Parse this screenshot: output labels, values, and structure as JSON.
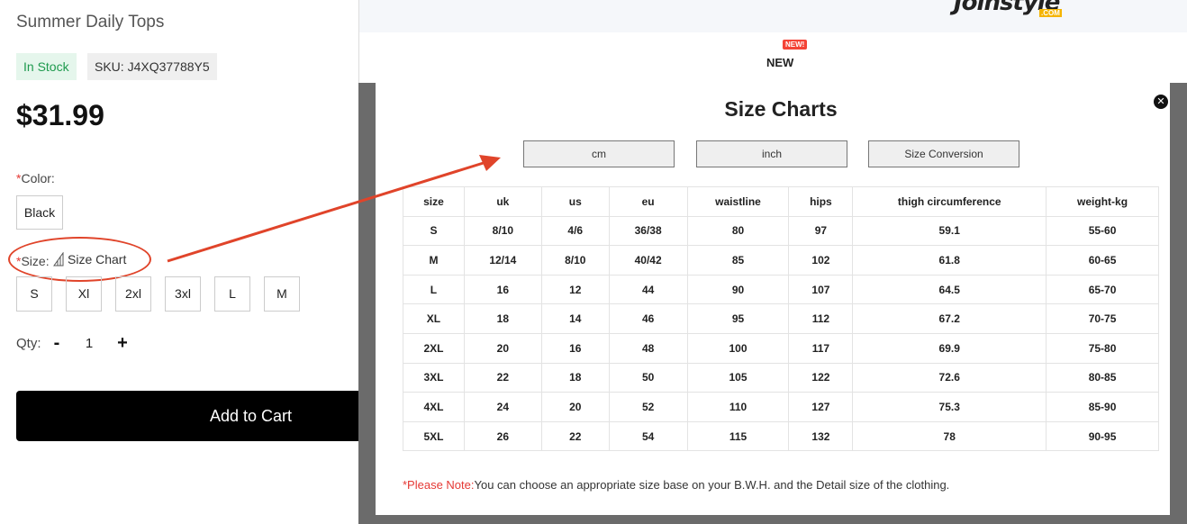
{
  "product": {
    "title": "Summer Daily Tops",
    "stock": "In Stock",
    "sku": "SKU: J4XQ37788Y5",
    "price": "$31.99",
    "color_label": "Color:",
    "color_value": "Black",
    "size_label": "Size:",
    "size_chart_link": "Size Chart",
    "sizes": [
      "S",
      "Xl",
      "2xl",
      "3xl",
      "L",
      "M"
    ],
    "qty_label": "Qty:",
    "qty_minus": "-",
    "qty_value": "1",
    "qty_plus": "+",
    "add_to_cart": "Add to Cart",
    "required_mark": "*"
  },
  "site": {
    "logo_text": "Joinstyle",
    "logo_suffix": ".COM",
    "nav_new": "NEW",
    "new_badge": "NEW!"
  },
  "size_chart": {
    "title": "Size Charts",
    "close_icon": "close-icon",
    "units": [
      "cm",
      "inch",
      "Size Conversion"
    ],
    "columns": [
      "size",
      "uk",
      "us",
      "eu",
      "waistline",
      "hips",
      "thigh circumference",
      "weight-kg"
    ],
    "rows": [
      [
        "S",
        "8/10",
        "4/6",
        "36/38",
        "80",
        "97",
        "59.1",
        "55-60"
      ],
      [
        "M",
        "12/14",
        "8/10",
        "40/42",
        "85",
        "102",
        "61.8",
        "60-65"
      ],
      [
        "L",
        "16",
        "12",
        "44",
        "90",
        "107",
        "64.5",
        "65-70"
      ],
      [
        "XL",
        "18",
        "14",
        "46",
        "95",
        "112",
        "67.2",
        "70-75"
      ],
      [
        "2XL",
        "20",
        "16",
        "48",
        "100",
        "117",
        "69.9",
        "75-80"
      ],
      [
        "3XL",
        "22",
        "18",
        "50",
        "105",
        "122",
        "72.6",
        "80-85"
      ],
      [
        "4XL",
        "24",
        "20",
        "52",
        "110",
        "127",
        "75.3",
        "85-90"
      ],
      [
        "5XL",
        "26",
        "22",
        "54",
        "115",
        "132",
        "78",
        "90-95"
      ]
    ],
    "note_label": "*Please Note:",
    "note_text": "You can choose an appropriate size base on your B.W.H. and the Detail size of the clothing."
  },
  "colors": {
    "accent_red": "#e0442a",
    "stock_green": "#1e9a4e",
    "button_black": "#000000"
  }
}
